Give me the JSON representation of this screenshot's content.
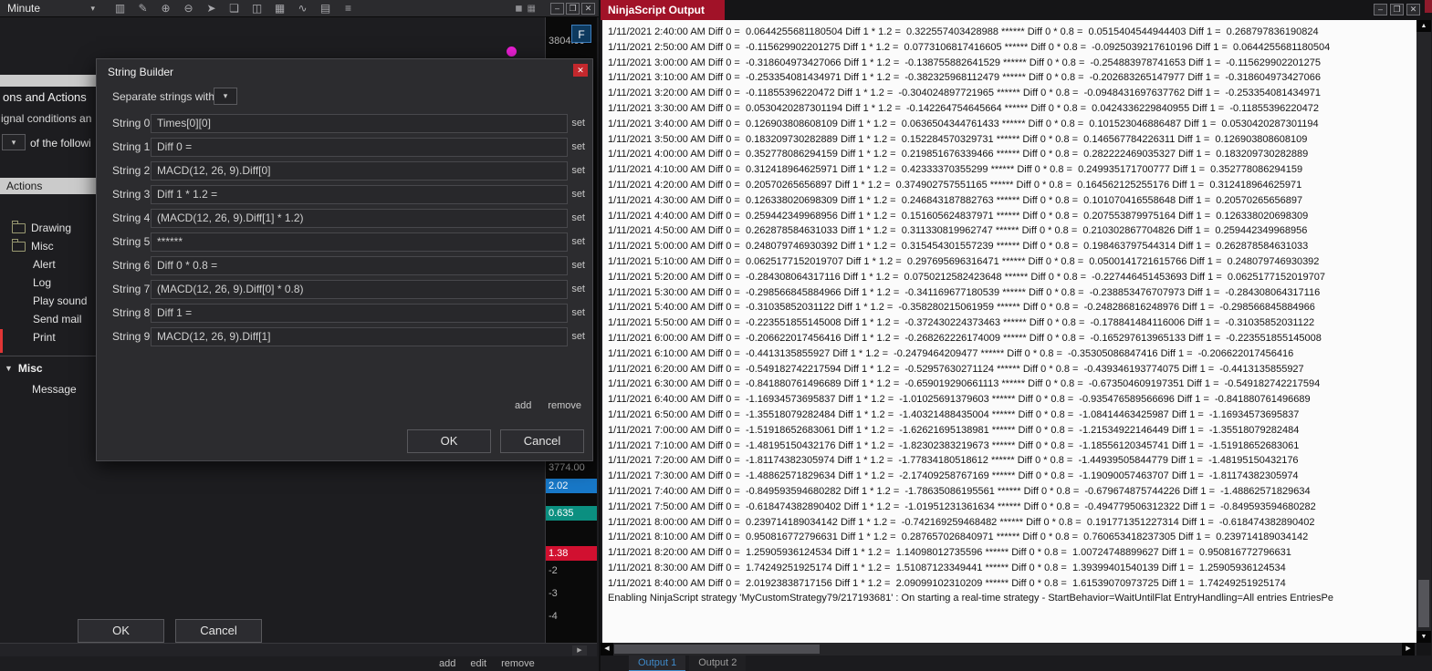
{
  "colors": {
    "accent_blue": "#1878c8",
    "badge_teal": "#0b8f80",
    "badge_red": "#d11030",
    "title_red": "#a11228",
    "tab_active_blue": "#3f8ac9",
    "close_button_red": "#c4282d",
    "marker_magenta": "#ea1fd3"
  },
  "left_window": {
    "toolbar": {
      "interval_label": "Minute",
      "icons": [
        {
          "name": "chart-style-icon",
          "glyph": "▥"
        },
        {
          "name": "pencil-draw-icon",
          "glyph": "✎"
        },
        {
          "name": "zoom-in-icon",
          "glyph": "⊕"
        },
        {
          "name": "zoom-out-icon",
          "glyph": "⊖"
        },
        {
          "name": "cursor-icon",
          "glyph": "➤"
        },
        {
          "name": "clipboard-icon",
          "glyph": "❏"
        },
        {
          "name": "panel-split-icon",
          "glyph": "◫"
        },
        {
          "name": "bars-grid-icon",
          "glyph": "▦"
        },
        {
          "name": "indicator-wave-icon",
          "glyph": "∿"
        },
        {
          "name": "data-box-icon",
          "glyph": "▤"
        },
        {
          "name": "list-icon",
          "glyph": "≡"
        }
      ],
      "right_icons": [
        {
          "name": "mini-chart-icon",
          "glyph": "◼"
        },
        {
          "name": "mini-grid-icon",
          "glyph": "▦"
        }
      ],
      "window_buttons": [
        {
          "name": "minimize-button",
          "glyph": "–"
        },
        {
          "name": "maximize-button",
          "glyph": "❐"
        },
        {
          "name": "close-button",
          "glyph": "✕"
        }
      ]
    },
    "panel": {
      "header_title": "ons and Actions",
      "subtitle": "ignal conditions an",
      "condition_dropdown_label": "of the followi",
      "actions_header": "Actions",
      "tree": {
        "folders": [
          {
            "label": "Drawing"
          },
          {
            "label": "Misc"
          }
        ],
        "items": [
          "Alert",
          "Log",
          "Play sound",
          "Send mail",
          "Print"
        ]
      },
      "misc_group": {
        "label": "Misc",
        "expander_glyph": "▼",
        "items": [
          "Message"
        ]
      },
      "ok_label": "OK",
      "cancel_label": "Cancel",
      "footer_links": [
        "add",
        "edit",
        "remove"
      ]
    },
    "price_axis": {
      "top_value": "3804.00",
      "f_badge": "F",
      "values": [
        {
          "text": "3774.00",
          "kind": "plain"
        },
        {
          "text": "2.02",
          "kind": "blue"
        },
        {
          "text": "0.635",
          "kind": "teal"
        },
        {
          "text": "1.38",
          "kind": "red"
        },
        {
          "text": "-2",
          "kind": "plain"
        },
        {
          "text": "-3",
          "kind": "plain"
        },
        {
          "text": "-4",
          "kind": "plain"
        }
      ]
    }
  },
  "dialog": {
    "title": "String Builder",
    "close_glyph": "✕",
    "separator_label": "Separate strings with",
    "combo_glyph": "▾",
    "set_label": "set",
    "rows": [
      {
        "label": "String 0",
        "value": "Times[0][0]"
      },
      {
        "label": "String 1",
        "value": "Diff 0 ="
      },
      {
        "label": "String 2",
        "value": "MACD(12, 26, 9).Diff[0]"
      },
      {
        "label": "String 3",
        "value": "Diff 1 * 1.2 ="
      },
      {
        "label": "String 4",
        "value": "(MACD(12, 26, 9).Diff[1] * 1.2)"
      },
      {
        "label": "String 5",
        "value": "******"
      },
      {
        "label": "String 6",
        "value": "Diff 0 * 0.8 ="
      },
      {
        "label": "String 7",
        "value": "(MACD(12, 26, 9).Diff[0] * 0.8)"
      },
      {
        "label": "String 8",
        "value": "Diff 1 ="
      },
      {
        "label": "String 9",
        "value": "MACD(12, 26, 9).Diff[1]"
      }
    ],
    "add_label": "add",
    "remove_label": "remove",
    "ok_label": "OK",
    "cancel_label": "Cancel"
  },
  "output_window": {
    "title": "NinjaScript Output",
    "window_buttons": [
      {
        "name": "minimize-button",
        "glyph": "–"
      },
      {
        "name": "maximize-button",
        "glyph": "❐"
      },
      {
        "name": "close-button",
        "glyph": "✕"
      }
    ],
    "lines": [
      "1/11/2021 2:40:00 AM Diff 0 =  0.0644255681180504 Diff 1 * 1.2 =  0.322557403428988 ****** Diff 0 * 0.8 =  0.0515404544944403 Diff 1 =  0.268797836190824",
      "1/11/2021 2:50:00 AM Diff 0 =  -0.115629902201275 Diff 1 * 1.2 =  0.0773106817416605 ****** Diff 0 * 0.8 =  -0.0925039217610196 Diff 1 =  0.0644255681180504",
      "1/11/2021 3:00:00 AM Diff 0 =  -0.318604973427066 Diff 1 * 1.2 =  -0.138755882641529 ****** Diff 0 * 0.8 =  -0.254883978741653 Diff 1 =  -0.115629902201275",
      "1/11/2021 3:10:00 AM Diff 0 =  -0.253354081434971 Diff 1 * 1.2 =  -0.382325968112479 ****** Diff 0 * 0.8 =  -0.202683265147977 Diff 1 =  -0.318604973427066",
      "1/11/2021 3:20:00 AM Diff 0 =  -0.11855396220472 Diff 1 * 1.2 =  -0.304024897721965 ****** Diff 0 * 0.8 =  -0.0948431697637762 Diff 1 =  -0.253354081434971",
      "1/11/2021 3:30:00 AM Diff 0 =  0.0530420287301194 Diff 1 * 1.2 =  -0.142264754645664 ****** Diff 0 * 0.8 =  0.0424336229840955 Diff 1 =  -0.11855396220472",
      "1/11/2021 3:40:00 AM Diff 0 =  0.126903808608109 Diff 1 * 1.2 =  0.0636504344761433 ****** Diff 0 * 0.8 =  0.101523046886487 Diff 1 =  0.0530420287301194",
      "1/11/2021 3:50:00 AM Diff 0 =  0.183209730282889 Diff 1 * 1.2 =  0.152284570329731 ****** Diff 0 * 0.8 =  0.146567784226311 Diff 1 =  0.126903808608109",
      "1/11/2021 4:00:00 AM Diff 0 =  0.352778086294159 Diff 1 * 1.2 =  0.219851676339466 ****** Diff 0 * 0.8 =  0.282222469035327 Diff 1 =  0.183209730282889",
      "1/11/2021 4:10:00 AM Diff 0 =  0.312418964625971 Diff 1 * 1.2 =  0.42333370355299 ****** Diff 0 * 0.8 =  0.249935171700777 Diff 1 =  0.352778086294159",
      "1/11/2021 4:20:00 AM Diff 0 =  0.20570265656897 Diff 1 * 1.2 =  0.374902757551165 ****** Diff 0 * 0.8 =  0.164562125255176 Diff 1 =  0.312418964625971",
      "1/11/2021 4:30:00 AM Diff 0 =  0.126338020698309 Diff 1 * 1.2 =  0.246843187882763 ****** Diff 0 * 0.8 =  0.101070416558648 Diff 1 =  0.20570265656897",
      "1/11/2021 4:40:00 AM Diff 0 =  0.259442349968956 Diff 1 * 1.2 =  0.151605624837971 ****** Diff 0 * 0.8 =  0.207553879975164 Diff 1 =  0.126338020698309",
      "1/11/2021 4:50:00 AM Diff 0 =  0.262878584631033 Diff 1 * 1.2 =  0.311330819962747 ****** Diff 0 * 0.8 =  0.210302867704826 Diff 1 =  0.259442349968956",
      "1/11/2021 5:00:00 AM Diff 0 =  0.248079746930392 Diff 1 * 1.2 =  0.315454301557239 ****** Diff 0 * 0.8 =  0.198463797544314 Diff 1 =  0.262878584631033",
      "1/11/2021 5:10:00 AM Diff 0 =  0.0625177152019707 Diff 1 * 1.2 =  0.297695696316471 ****** Diff 0 * 0.8 =  0.0500141721615766 Diff 1 =  0.248079746930392",
      "1/11/2021 5:20:00 AM Diff 0 =  -0.284308064317116 Diff 1 * 1.2 =  0.0750212582423648 ****** Diff 0 * 0.8 =  -0.227446451453693 Diff 1 =  0.0625177152019707",
      "1/11/2021 5:30:00 AM Diff 0 =  -0.298566845884966 Diff 1 * 1.2 =  -0.341169677180539 ****** Diff 0 * 0.8 =  -0.238853476707973 Diff 1 =  -0.284308064317116",
      "1/11/2021 5:40:00 AM Diff 0 =  -0.31035852031122 Diff 1 * 1.2 =  -0.358280215061959 ****** Diff 0 * 0.8 =  -0.248286816248976 Diff 1 =  -0.298566845884966",
      "1/11/2021 5:50:00 AM Diff 0 =  -0.223551855145008 Diff 1 * 1.2 =  -0.372430224373463 ****** Diff 0 * 0.8 =  -0.178841484116006 Diff 1 =  -0.31035852031122",
      "1/11/2021 6:00:00 AM Diff 0 =  -0.206622017456416 Diff 1 * 1.2 =  -0.268262226174009 ****** Diff 0 * 0.8 =  -0.165297613965133 Diff 1 =  -0.223551855145008",
      "1/11/2021 6:10:00 AM Diff 0 =  -0.4413135855927 Diff 1 * 1.2 =  -0.2479464209477 ****** Diff 0 * 0.8 =  -0.35305086847416 Diff 1 =  -0.206622017456416",
      "1/11/2021 6:20:00 AM Diff 0 =  -0.549182742217594 Diff 1 * 1.2 =  -0.52957630271124 ****** Diff 0 * 0.8 =  -0.439346193774075 Diff 1 =  -0.4413135855927",
      "1/11/2021 6:30:00 AM Diff 0 =  -0.841880761496689 Diff 1 * 1.2 =  -0.659019290661113 ****** Diff 0 * 0.8 =  -0.673504609197351 Diff 1 =  -0.549182742217594",
      "1/11/2021 6:40:00 AM Diff 0 =  -1.16934573695837 Diff 1 * 1.2 =  -1.01025691379603 ****** Diff 0 * 0.8 =  -0.935476589566696 Diff 1 =  -0.841880761496689",
      "1/11/2021 6:50:00 AM Diff 0 =  -1.35518079282484 Diff 1 * 1.2 =  -1.40321488435004 ****** Diff 0 * 0.8 =  -1.08414463425987 Diff 1 =  -1.16934573695837",
      "1/11/2021 7:00:00 AM Diff 0 =  -1.51918652683061 Diff 1 * 1.2 =  -1.62621695138981 ****** Diff 0 * 0.8 =  -1.21534922146449 Diff 1 =  -1.35518079282484",
      "1/11/2021 7:10:00 AM Diff 0 =  -1.48195150432176 Diff 1 * 1.2 =  -1.82302383219673 ****** Diff 0 * 0.8 =  -1.18556120345741 Diff 1 =  -1.51918652683061",
      "1/11/2021 7:20:00 AM Diff 0 =  -1.81174382305974 Diff 1 * 1.2 =  -1.77834180518612 ****** Diff 0 * 0.8 =  -1.44939505844779 Diff 1 =  -1.48195150432176",
      "1/11/2021 7:30:00 AM Diff 0 =  -1.48862571829634 Diff 1 * 1.2 =  -2.17409258767169 ****** Diff 0 * 0.8 =  -1.19090057463707 Diff 1 =  -1.81174382305974",
      "1/11/2021 7:40:00 AM Diff 0 =  -0.849593594680282 Diff 1 * 1.2 =  -1.78635086195561 ****** Diff 0 * 0.8 =  -0.679674875744226 Diff 1 =  -1.48862571829634",
      "1/11/2021 7:50:00 AM Diff 0 =  -0.618474382890402 Diff 1 * 1.2 =  -1.01951231361634 ****** Diff 0 * 0.8 =  -0.494779506312322 Diff 1 =  -0.849593594680282",
      "1/11/2021 8:00:00 AM Diff 0 =  0.239714189034142 Diff 1 * 1.2 =  -0.742169259468482 ****** Diff 0 * 0.8 =  0.191771351227314 Diff 1 =  -0.618474382890402",
      "1/11/2021 8:10:00 AM Diff 0 =  0.950816772796631 Diff 1 * 1.2 =  0.287657026840971 ****** Diff 0 * 0.8 =  0.760653418237305 Diff 1 =  0.239714189034142",
      "1/11/2021 8:20:00 AM Diff 0 =  1.25905936124534 Diff 1 * 1.2 =  1.14098012735596 ****** Diff 0 * 0.8 =  1.00724748899627 Diff 1 =  0.950816772796631",
      "1/11/2021 8:30:00 AM Diff 0 =  1.74249251925174 Diff 1 * 1.2 =  1.51087123349441 ****** Diff 0 * 0.8 =  1.39399401540139 Diff 1 =  1.25905936124534",
      "1/11/2021 8:40:00 AM Diff 0 =  2.01923838717156 Diff 1 * 1.2 =  2.09099102310209 ****** Diff 0 * 0.8 =  1.61539070973725 Diff 1 =  1.74249251925174",
      "Enabling NinjaScript strategy 'MyCustomStrategy79/217193681' : On starting a real-time strategy - StartBehavior=WaitUntilFlat EntryHandling=All entries EntriesPe"
    ],
    "tabs": [
      {
        "label": "Output 1",
        "state": "active"
      },
      {
        "label": "Output 2",
        "state": ""
      }
    ]
  }
}
